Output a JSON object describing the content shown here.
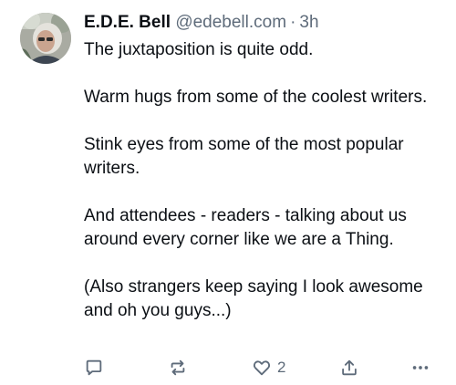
{
  "post": {
    "author": {
      "display_name": "E.D.E. Bell",
      "handle": "@edebell.com",
      "separator": "·",
      "time": "3h"
    },
    "paragraphs": [
      "The juxtaposition is quite odd.",
      "Warm hugs from some of the coolest writers.",
      "Stink eyes from some of the most popular writers.",
      "And attendees - readers - talking about us around every corner like we are a Thing.",
      "(Also strangers keep saying I look awesome and oh you guys...)"
    ],
    "actions": {
      "reply_icon": "speech-bubble-icon",
      "repost_icon": "repost-arrows-icon",
      "like_icon": "heart-icon",
      "like_count": "2",
      "share_icon": "share-upload-icon",
      "more_icon": "ellipsis-icon"
    }
  },
  "colors": {
    "text": "#0b0f14",
    "muted": "#5e6b7a",
    "background": "#ffffff"
  }
}
